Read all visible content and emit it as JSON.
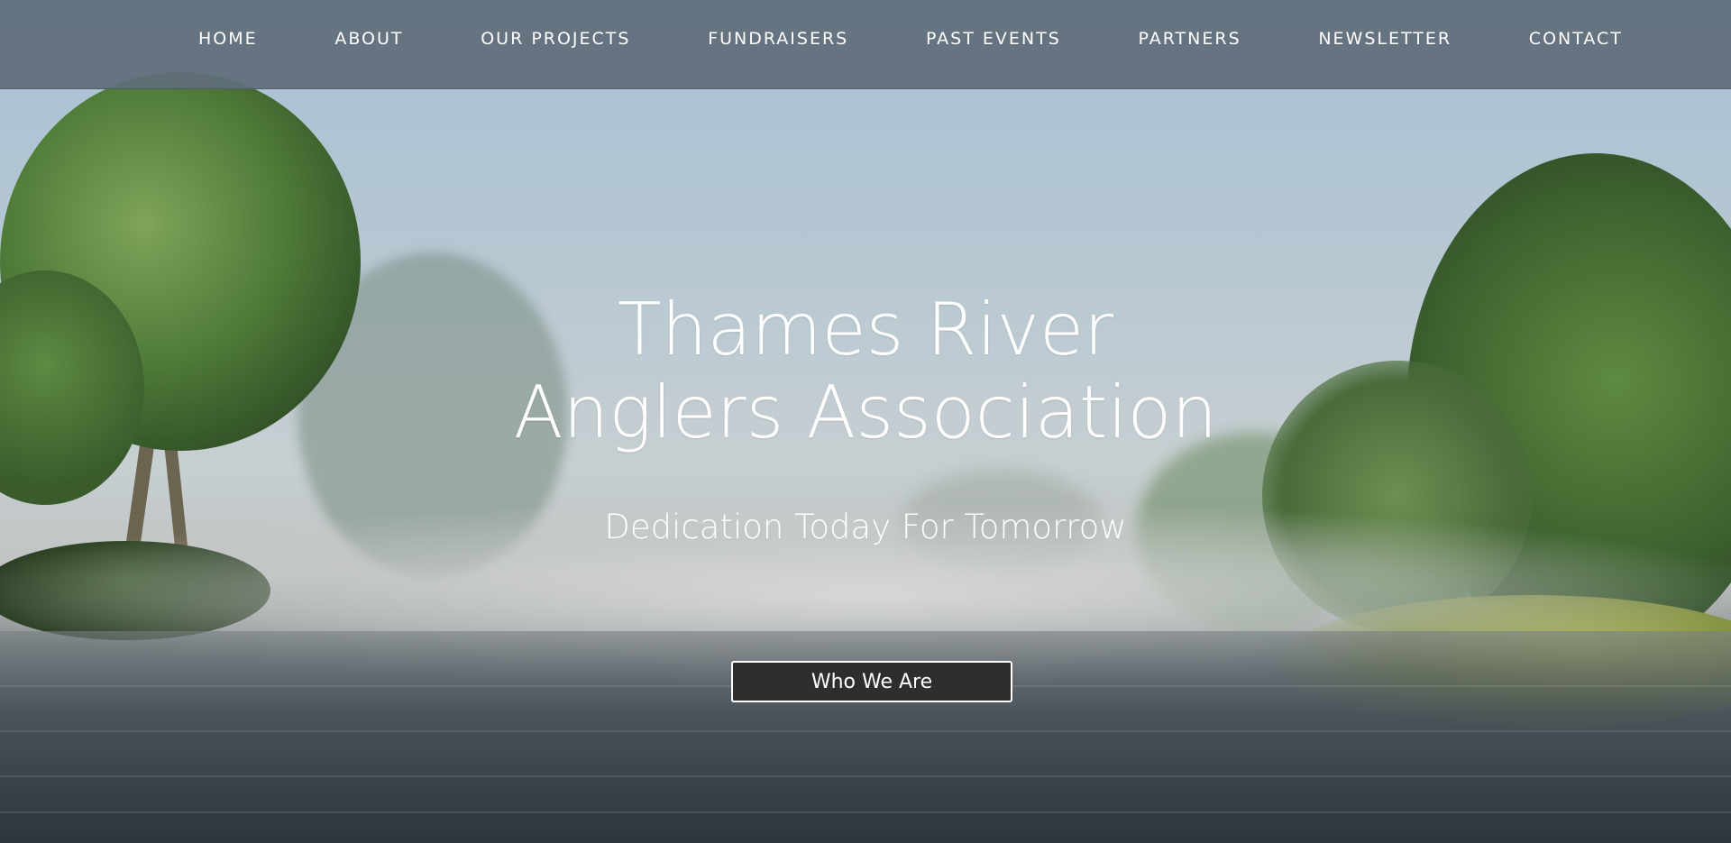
{
  "nav": {
    "items": [
      {
        "label": "HOME"
      },
      {
        "label": "ABOUT"
      },
      {
        "label": "OUR PROJECTS"
      },
      {
        "label": "FUNDRAISERS"
      },
      {
        "label": "PAST EVENTS"
      },
      {
        "label": "PARTNERS"
      },
      {
        "label": "NEWSLETTER"
      },
      {
        "label": "CONTACT"
      }
    ]
  },
  "hero": {
    "title_line1": "Thames River",
    "title_line2": "Anglers Association",
    "tagline": "Dedication Today For Tomorrow",
    "cta_label": "Who We Are"
  },
  "colors": {
    "nav_background": "#606e7a",
    "cta_background": "#2e2e2f",
    "text": "#ffffff"
  }
}
